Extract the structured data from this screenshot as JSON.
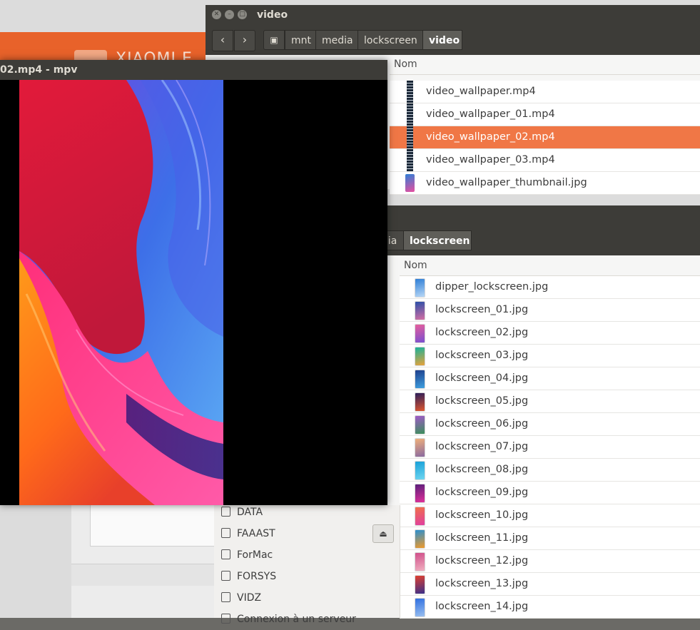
{
  "browser": {
    "brand": "XIAOMI E"
  },
  "fm1": {
    "title": "video",
    "nav": {
      "back": "‹",
      "forward": "›"
    },
    "breadcrumbs": [
      {
        "label": "mnt",
        "active": false
      },
      {
        "label": "media",
        "active": false
      },
      {
        "label": "lockscreen",
        "active": false
      },
      {
        "label": "video",
        "active": true
      }
    ],
    "column_header": "Nom",
    "files": [
      {
        "name": "video_wallpaper.mp4",
        "type": "video",
        "selected": false
      },
      {
        "name": "video_wallpaper_01.mp4",
        "type": "video",
        "selected": false
      },
      {
        "name": "video_wallpaper_02.mp4",
        "type": "video",
        "selected": true
      },
      {
        "name": "video_wallpaper_03.mp4",
        "type": "video",
        "selected": false
      },
      {
        "name": "video_wallpaper_thumbnail.jpg",
        "type": "image",
        "selected": false
      }
    ]
  },
  "fm2": {
    "breadcrumbs": [
      {
        "label": "dia",
        "active": false
      },
      {
        "label": "lockscreen",
        "active": true
      }
    ],
    "column_header": "Nom",
    "files": [
      {
        "name": "dipper_lockscreen.jpg",
        "colors": [
          "#2f7fd6",
          "#b7d7f6"
        ]
      },
      {
        "name": "lockscreen_01.jpg",
        "colors": [
          "#2a4fa8",
          "#d56fa4"
        ]
      },
      {
        "name": "lockscreen_02.jpg",
        "colors": [
          "#e65f9c",
          "#7a4fd0"
        ]
      },
      {
        "name": "lockscreen_03.jpg",
        "colors": [
          "#19b29a",
          "#e8a23a"
        ]
      },
      {
        "name": "lockscreen_04.jpg",
        "colors": [
          "#1e3f8c",
          "#3fa0e0"
        ]
      },
      {
        "name": "lockscreen_05.jpg",
        "colors": [
          "#2a1e5a",
          "#e0572f"
        ]
      },
      {
        "name": "lockscreen_06.jpg",
        "colors": [
          "#a05ac8",
          "#3a8f5a"
        ]
      },
      {
        "name": "lockscreen_07.jpg",
        "colors": [
          "#f0b07a",
          "#8a6aa0"
        ]
      },
      {
        "name": "lockscreen_08.jpg",
        "colors": [
          "#18a0d8",
          "#6fd6f0"
        ]
      },
      {
        "name": "lockscreen_09.jpg",
        "colors": [
          "#5a1f7a",
          "#e0309a"
        ]
      },
      {
        "name": "lockscreen_10.jpg",
        "colors": [
          "#f0704a",
          "#e03fa0"
        ]
      },
      {
        "name": "lockscreen_11.jpg",
        "colors": [
          "#2a8fd0",
          "#f09a2a"
        ]
      },
      {
        "name": "lockscreen_12.jpg",
        "colors": [
          "#d04f8a",
          "#f0b0c0"
        ]
      },
      {
        "name": "lockscreen_13.jpg",
        "colors": [
          "#e0402f",
          "#3a2f8a"
        ]
      },
      {
        "name": "lockscreen_14.jpg",
        "colors": [
          "#2f6fe0",
          "#9ac0f0"
        ]
      }
    ],
    "sidebar": [
      {
        "name": "DATA"
      },
      {
        "name": "FAAAST"
      },
      {
        "name": "ForMac"
      },
      {
        "name": "FORSYS"
      },
      {
        "name": "VIDZ"
      },
      {
        "name": "Connexion à un serveur"
      }
    ]
  },
  "mpv": {
    "title": "02.mp4 - mpv"
  },
  "colors": {
    "selection": "#f07746",
    "titlebar": "#3d3c38"
  }
}
